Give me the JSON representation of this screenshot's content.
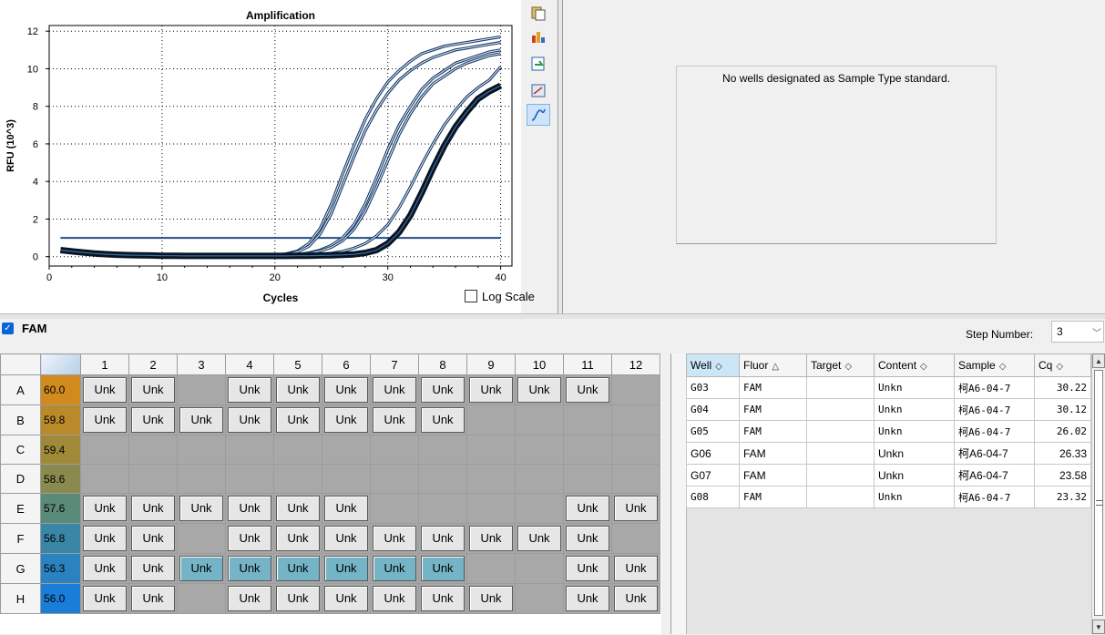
{
  "chart_data": {
    "type": "line",
    "title": "Amplification",
    "xlabel": "Cycles",
    "ylabel": "RFU (10^3)",
    "xlim": [
      0,
      41
    ],
    "ylim": [
      -0.5,
      12.3
    ],
    "xticks": [
      0,
      10,
      20,
      30,
      40
    ],
    "yticks": [
      0,
      2,
      4,
      6,
      8,
      10,
      12
    ],
    "grid": true,
    "threshold": 1.0,
    "log_scale_label": "Log Scale",
    "log_scale": false,
    "x": [
      1,
      2,
      3,
      4,
      5,
      6,
      7,
      8,
      9,
      10,
      11,
      12,
      13,
      14,
      15,
      16,
      17,
      18,
      19,
      20,
      21,
      22,
      23,
      24,
      25,
      26,
      27,
      28,
      29,
      30,
      31,
      32,
      33,
      34,
      35,
      36,
      37,
      38,
      39,
      40
    ],
    "series": [
      {
        "values": [
          0.3,
          0.25,
          0.2,
          0.15,
          0.12,
          0.1,
          0.08,
          0.07,
          0.06,
          0.05,
          0.05,
          0.05,
          0.04,
          0.04,
          0.04,
          0.04,
          0.04,
          0.05,
          0.06,
          0.08,
          0.15,
          0.3,
          0.7,
          1.5,
          2.8,
          4.4,
          5.9,
          7.3,
          8.4,
          9.3,
          9.9,
          10.4,
          10.8,
          11.0,
          11.2,
          11.3,
          11.4,
          11.5,
          11.6,
          11.7
        ],
        "highlight": false
      },
      {
        "values": [
          0.3,
          0.25,
          0.2,
          0.15,
          0.12,
          0.1,
          0.08,
          0.07,
          0.06,
          0.05,
          0.05,
          0.05,
          0.04,
          0.04,
          0.04,
          0.04,
          0.04,
          0.05,
          0.06,
          0.08,
          0.12,
          0.25,
          0.55,
          1.2,
          2.3,
          3.8,
          5.3,
          6.7,
          7.8,
          8.7,
          9.4,
          9.9,
          10.3,
          10.6,
          10.8,
          11.0,
          11.1,
          11.2,
          11.3,
          11.4
        ],
        "highlight": false
      },
      {
        "values": [
          0.3,
          0.25,
          0.2,
          0.15,
          0.12,
          0.1,
          0.08,
          0.07,
          0.06,
          0.05,
          0.05,
          0.05,
          0.04,
          0.04,
          0.04,
          0.04,
          0.04,
          0.04,
          0.05,
          0.06,
          0.08,
          0.12,
          0.2,
          0.35,
          0.6,
          1.0,
          1.7,
          2.8,
          4.2,
          5.7,
          7.0,
          8.0,
          8.9,
          9.5,
          9.9,
          10.3,
          10.5,
          10.7,
          10.9,
          11.0
        ],
        "highlight": false
      },
      {
        "values": [
          0.3,
          0.25,
          0.2,
          0.15,
          0.12,
          0.1,
          0.08,
          0.07,
          0.06,
          0.05,
          0.05,
          0.05,
          0.04,
          0.04,
          0.04,
          0.04,
          0.04,
          0.04,
          0.05,
          0.06,
          0.07,
          0.1,
          0.17,
          0.3,
          0.5,
          0.85,
          1.45,
          2.4,
          3.7,
          5.1,
          6.5,
          7.6,
          8.5,
          9.2,
          9.6,
          10.0,
          10.3,
          10.5,
          10.7,
          10.8
        ],
        "highlight": false
      },
      {
        "values": [
          0.3,
          0.25,
          0.2,
          0.15,
          0.12,
          0.1,
          0.08,
          0.07,
          0.06,
          0.05,
          0.05,
          0.05,
          0.04,
          0.04,
          0.04,
          0.04,
          0.04,
          0.04,
          0.04,
          0.05,
          0.05,
          0.06,
          0.08,
          0.12,
          0.18,
          0.28,
          0.45,
          0.7,
          1.1,
          1.7,
          2.6,
          3.7,
          4.9,
          6.0,
          7.0,
          7.8,
          8.5,
          9.0,
          9.4,
          10.1
        ],
        "highlight": false
      },
      {
        "values": [
          0.35,
          0.28,
          0.22,
          0.17,
          0.13,
          0.1,
          0.08,
          0.07,
          0.06,
          0.05,
          0.05,
          0.04,
          0.04,
          0.04,
          0.04,
          0.04,
          0.04,
          0.04,
          0.04,
          0.04,
          0.04,
          0.05,
          0.05,
          0.06,
          0.07,
          0.09,
          0.12,
          0.2,
          0.35,
          0.7,
          1.3,
          2.2,
          3.4,
          4.7,
          5.9,
          6.9,
          7.7,
          8.4,
          8.8,
          9.1
        ],
        "highlight": true
      }
    ]
  },
  "toolbar": {
    "icons": [
      "copy-icon",
      "chart-settings-icon",
      "export-icon",
      "zoom-icon",
      "amplification-mode-icon"
    ]
  },
  "standard_curve": {
    "message": "No wells designated as Sample Type standard."
  },
  "fluor": {
    "label": "FAM",
    "checked": true
  },
  "step": {
    "label": "Step Number:",
    "value": "3"
  },
  "plate": {
    "columns": [
      "1",
      "2",
      "3",
      "4",
      "5",
      "6",
      "7",
      "8",
      "9",
      "10",
      "11",
      "12"
    ],
    "rows": [
      {
        "label": "A",
        "temp": "60.0",
        "temp_color": "#d08a1e",
        "wells": [
          "Unk",
          "Unk",
          "",
          "Unk",
          "Unk",
          "Unk",
          "Unk",
          "Unk",
          "Unk",
          "Unk",
          "Unk",
          ""
        ],
        "selected": []
      },
      {
        "label": "B",
        "temp": "59.8",
        "temp_color": "#b98a2a",
        "wells": [
          "Unk",
          "Unk",
          "Unk",
          "Unk",
          "Unk",
          "Unk",
          "Unk",
          "Unk",
          "",
          "",
          "",
          ""
        ],
        "selected": []
      },
      {
        "label": "C",
        "temp": "59.4",
        "temp_color": "#a08a3a",
        "wells": [
          "",
          "",
          "",
          "",
          "",
          "",
          "",
          "",
          "",
          "",
          "",
          ""
        ],
        "selected": []
      },
      {
        "label": "D",
        "temp": "58.6",
        "temp_color": "#8a8a50",
        "wells": [
          "",
          "",
          "",
          "",
          "",
          "",
          "",
          "",
          "",
          "",
          "",
          ""
        ],
        "selected": []
      },
      {
        "label": "E",
        "temp": "57.6",
        "temp_color": "#5a8a78",
        "wells": [
          "Unk",
          "Unk",
          "Unk",
          "Unk",
          "Unk",
          "Unk",
          "",
          "",
          "",
          "",
          "Unk",
          "Unk"
        ],
        "selected": []
      },
      {
        "label": "F",
        "temp": "56.8",
        "temp_color": "#3a86a6",
        "wells": [
          "Unk",
          "Unk",
          "",
          "Unk",
          "Unk",
          "Unk",
          "Unk",
          "Unk",
          "Unk",
          "Unk",
          "Unk",
          ""
        ],
        "selected": []
      },
      {
        "label": "G",
        "temp": "56.3",
        "temp_color": "#2a82c0",
        "wells": [
          "Unk",
          "Unk",
          "Unk",
          "Unk",
          "Unk",
          "Unk",
          "Unk",
          "Unk",
          "",
          "",
          "Unk",
          "Unk"
        ],
        "selected": [
          2,
          3,
          4,
          5,
          6,
          7
        ]
      },
      {
        "label": "H",
        "temp": "56.0",
        "temp_color": "#1a7ed8",
        "wells": [
          "Unk",
          "Unk",
          "",
          "Unk",
          "Unk",
          "Unk",
          "Unk",
          "Unk",
          "Unk",
          "",
          "Unk",
          "Unk"
        ],
        "selected": []
      }
    ]
  },
  "results": {
    "headers": [
      "Well",
      "Fluor",
      "Target",
      "Content",
      "Sample",
      "Cq"
    ],
    "rows": [
      {
        "well": "G03",
        "fluor": "FAM",
        "target": "",
        "content": "Unkn",
        "sample": "柯A6-04-7",
        "cq": "30.22",
        "mono": true
      },
      {
        "well": "G04",
        "fluor": "FAM",
        "target": "",
        "content": "Unkn",
        "sample": "柯A6-04-7",
        "cq": "30.12",
        "mono": true
      },
      {
        "well": "G05",
        "fluor": "FAM",
        "target": "",
        "content": "Unkn",
        "sample": "柯A6-04-7",
        "cq": "26.02",
        "mono": true
      },
      {
        "well": "G06",
        "fluor": "FAM",
        "target": "",
        "content": "Unkn",
        "sample": "柯A6-04-7",
        "cq": "26.33",
        "mono": false
      },
      {
        "well": "G07",
        "fluor": "FAM",
        "target": "",
        "content": "Unkn",
        "sample": "柯A6-04-7",
        "cq": "23.58",
        "mono": false
      },
      {
        "well": "G08",
        "fluor": "FAM",
        "target": "",
        "content": "Unkn",
        "sample": "柯A6-04-7",
        "cq": "23.32",
        "mono": true
      }
    ]
  }
}
